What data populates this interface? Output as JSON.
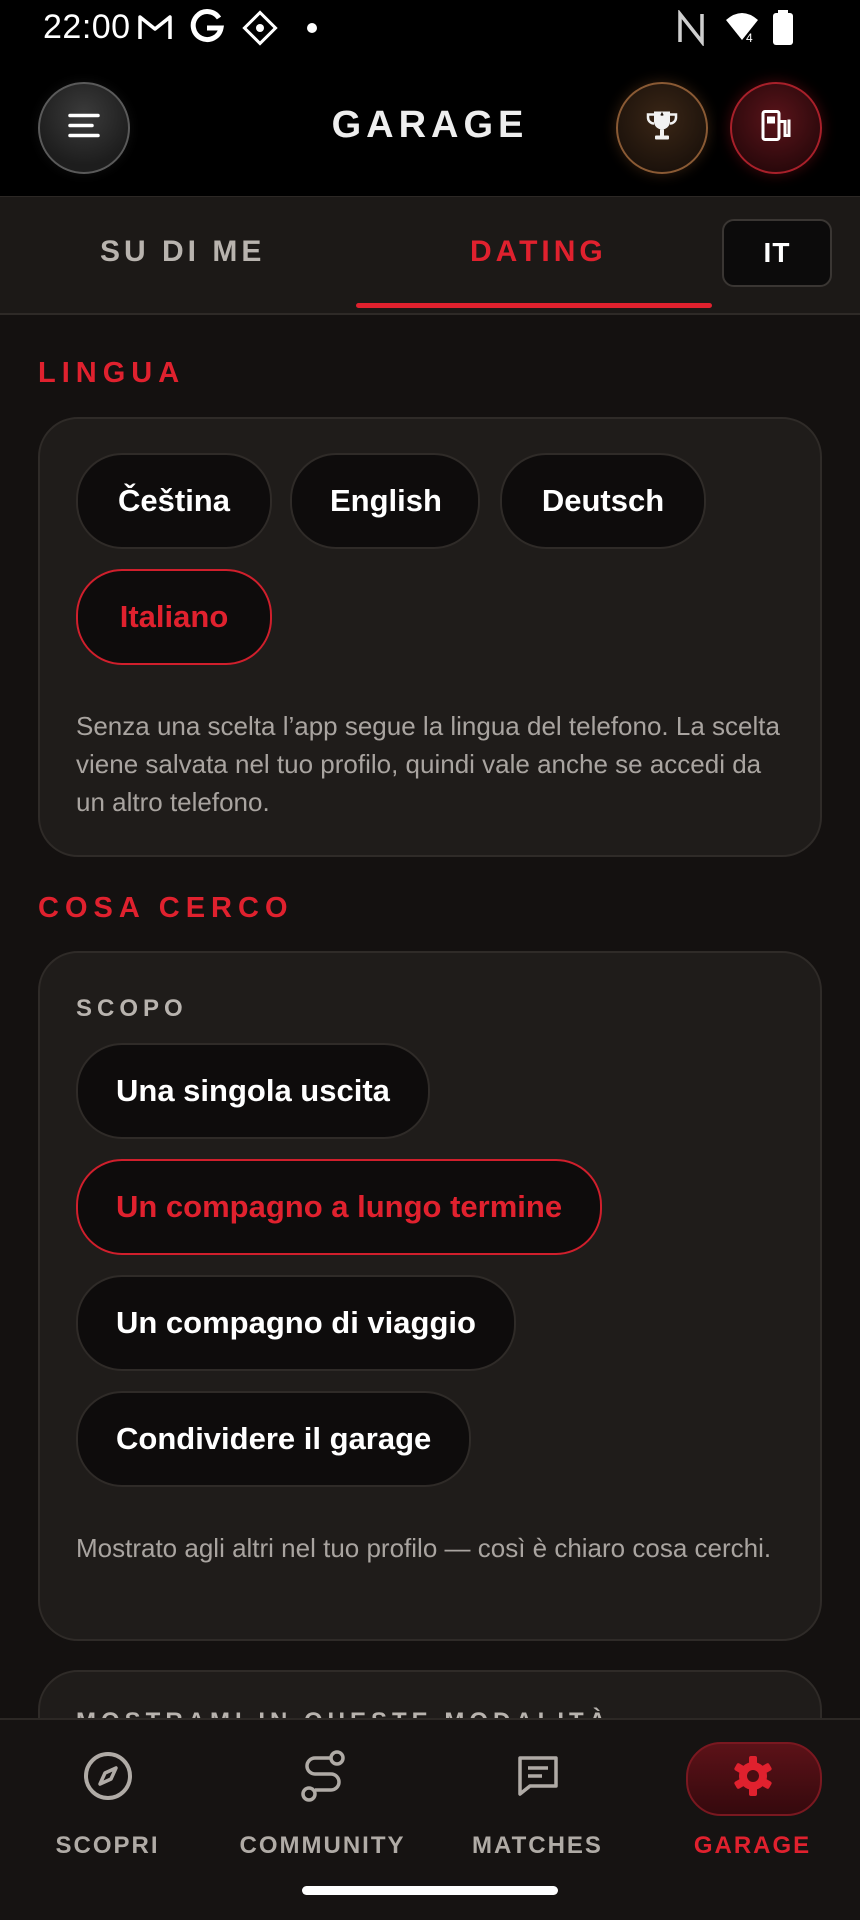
{
  "status_bar": {
    "time": "22:00"
  },
  "header": {
    "title": "GARAGE"
  },
  "tabs": {
    "about": "SU DI ME",
    "dating": "DATING",
    "language_badge": "IT"
  },
  "language_section": {
    "title": "LINGUA",
    "options": [
      "Čeština",
      "English",
      "Deutsch",
      "Italiano"
    ],
    "selected": "Italiano",
    "note": "Senza una scelta l’app segue la lingua del telefono. La scelta viene salvata nel tuo profilo, quindi vale anche se accedi da un altro telefono."
  },
  "looking_for_section": {
    "title": "COSA CERCO",
    "purpose_label": "SCOPO",
    "options": [
      "Una singola uscita",
      "Un compagno a lungo termine",
      "Un compagno di viaggio",
      "Condividere il garage"
    ],
    "selected": "Un compagno a lungo termine",
    "note": "Mostrato agli altri nel tuo profilo — così è chiaro cosa cerchi."
  },
  "next_section": {
    "label": "MOSTRAMI IN QUESTE MODALITÀ"
  },
  "bottom_nav": {
    "items": [
      {
        "label": "SCOPRI",
        "icon": "compass-icon"
      },
      {
        "label": "COMMUNITY",
        "icon": "route-icon"
      },
      {
        "label": "MATCHES",
        "icon": "chat-icon"
      },
      {
        "label": "GARAGE",
        "icon": "gear-icon"
      }
    ],
    "active": "GARAGE"
  },
  "colors": {
    "accent": "#e0212e",
    "background": "#141110",
    "card": "#1f1c1a",
    "trophy": "#c9844a"
  }
}
